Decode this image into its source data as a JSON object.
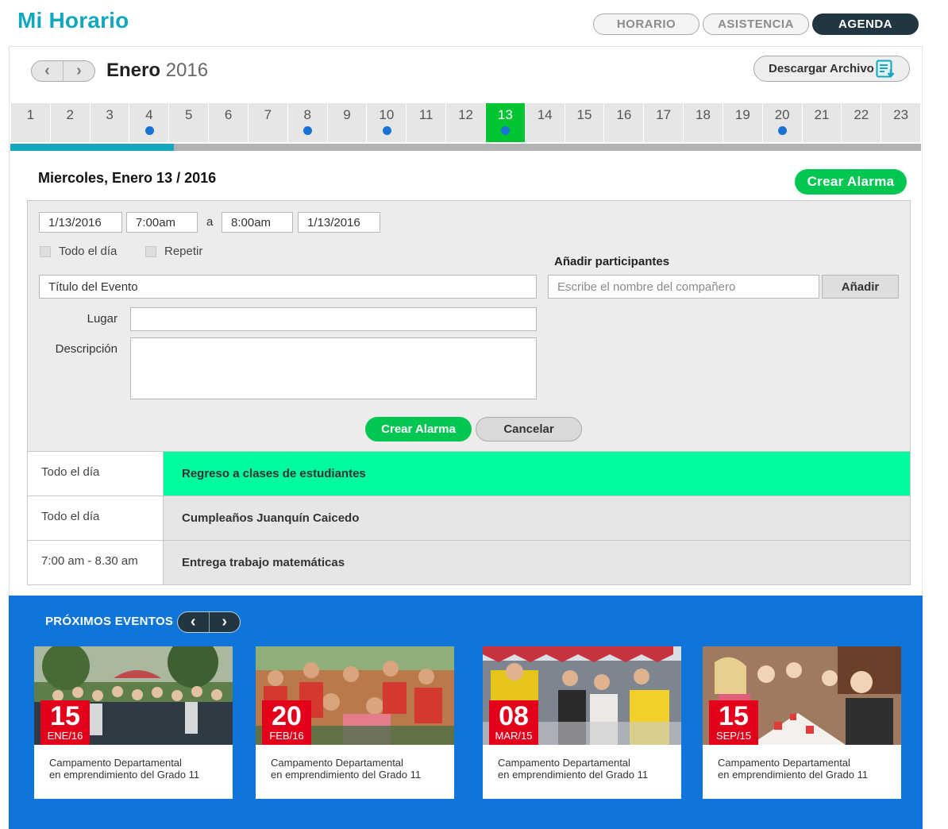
{
  "app_title": "Mi Horario",
  "topnav": [
    {
      "label": "HORARIO",
      "active": false
    },
    {
      "label": "ASISTENCIA",
      "active": false
    },
    {
      "label": "AGENDA",
      "active": true
    }
  ],
  "calendar": {
    "month": "Enero",
    "year": "2016",
    "download_label": "Descargar Archivo",
    "days": [
      {
        "n": "1"
      },
      {
        "n": "2"
      },
      {
        "n": "3"
      },
      {
        "n": "4",
        "dot": true
      },
      {
        "n": "5"
      },
      {
        "n": "6"
      },
      {
        "n": "7"
      },
      {
        "n": "8",
        "dot": true
      },
      {
        "n": "9"
      },
      {
        "n": "10",
        "dot": true
      },
      {
        "n": "11"
      },
      {
        "n": "12"
      },
      {
        "n": "13",
        "dot": true,
        "selected": true
      },
      {
        "n": "14"
      },
      {
        "n": "15"
      },
      {
        "n": "16"
      },
      {
        "n": "17"
      },
      {
        "n": "18"
      },
      {
        "n": "19"
      },
      {
        "n": "20",
        "dot": true
      },
      {
        "n": "21"
      },
      {
        "n": "22"
      },
      {
        "n": "23"
      }
    ],
    "progress_fraction": 0.18
  },
  "day_view": {
    "heading": "Miercoles, Enero 13 / 2016",
    "create_alarm_label": "Crear Alarma"
  },
  "form": {
    "start_date": "1/13/2016",
    "start_time": "7:00am",
    "separator": "a",
    "end_time": "8:00am",
    "end_date": "1/13/2016",
    "all_day_label": "Todo el día",
    "repeat_label": "Repetir",
    "title_value": "Título del Evento",
    "place_label": "Lugar",
    "description_label": "Descripción",
    "participants_title": "Añadir participantes",
    "participants_placeholder": "Escribe el nombre del compañero",
    "add_label": "Añadir",
    "submit_label": "Crear Alarma",
    "cancel_label": "Cancelar"
  },
  "events": [
    {
      "time": "Todo el día",
      "title": "Regreso a clases de estudiantes",
      "highlight": true
    },
    {
      "time": "Todo el día",
      "title": "Cumpleaños Juanquín Caicedo",
      "highlight": false
    },
    {
      "time": "7:00 am - 8.30 am",
      "title": "Entrega trabajo matemáticas",
      "highlight": false
    }
  ],
  "upcoming": {
    "title": "PRÓXIMOS EVENTOS",
    "cards": [
      {
        "day": "15",
        "month": "ENE/16",
        "line1": "Campamento Departamental",
        "line2": "en emprendimiento del Grado 11",
        "photo": "group-outdoor"
      },
      {
        "day": "20",
        "month": "FEB/16",
        "line1": "Campamento Departamental",
        "line2": "en emprendimiento del Grado 11",
        "photo": "crowd-celebration"
      },
      {
        "day": "08",
        "month": "MAR/15",
        "line1": "Campamento Departamental",
        "line2": "en emprendimiento del Grado 11",
        "photo": "market-stall"
      },
      {
        "day": "15",
        "month": "SEP/15",
        "line1": "Campamento Departamental",
        "line2": "en emprendimiento del Grado 11",
        "photo": "dinner-table"
      }
    ]
  },
  "colors": {
    "brand": "#12a7bd",
    "nav_active": "#223641",
    "selected_day": "#00c532",
    "event_dot": "#1873d4",
    "green_button": "#00c752",
    "event_highlight": "#00fa9e",
    "upcoming_bg": "#0f75d9",
    "date_badge": "#e3001b"
  }
}
